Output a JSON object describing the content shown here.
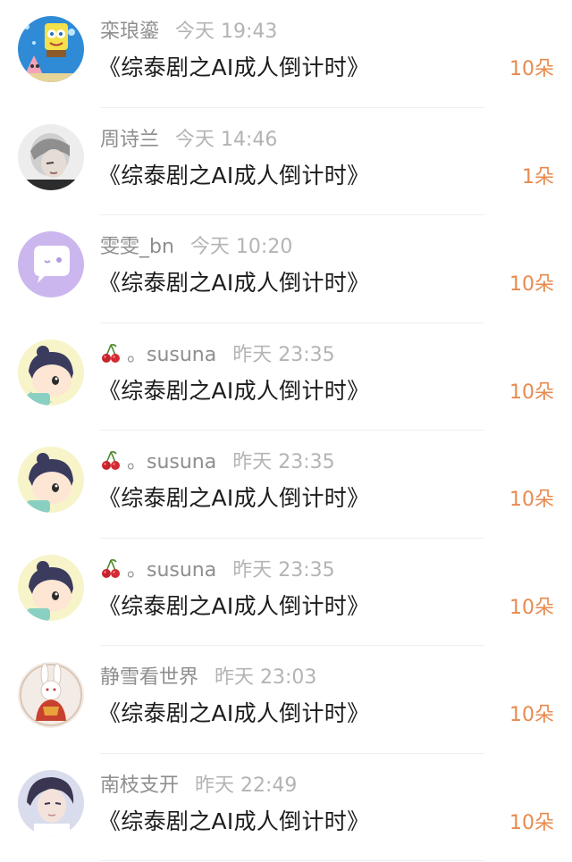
{
  "gifts": [
    {
      "name": "栾琅鎏",
      "time": "今天 19:43",
      "title": "《综泰剧之AI成人倒计时》",
      "count": "10朵",
      "avatar": "spongebob-avatar"
    },
    {
      "name": "周诗兰",
      "time": "今天 14:46",
      "title": "《综泰剧之AI成人倒计时》",
      "count": "1朵",
      "avatar": "grey-hair-person-avatar"
    },
    {
      "name": "雯雯_bn",
      "time": "今天 10:20",
      "title": "《综泰剧之AI成人倒计时》",
      "count": "10朵",
      "avatar": "purple-chat-bubble-avatar"
    },
    {
      "name": "。susuna",
      "time": "昨天 23:35",
      "title": "《综泰剧之AI成人倒计时》",
      "count": "10朵",
      "avatar": "cartoon-boy-avatar",
      "prefix_icon": "cherry-icon"
    },
    {
      "name": "。susuna",
      "time": "昨天 23:35",
      "title": "《综泰剧之AI成人倒计时》",
      "count": "10朵",
      "avatar": "cartoon-boy-avatar",
      "prefix_icon": "cherry-icon"
    },
    {
      "name": "。susuna",
      "time": "昨天 23:35",
      "title": "《综泰剧之AI成人倒计时》",
      "count": "10朵",
      "avatar": "cartoon-boy-avatar",
      "prefix_icon": "cherry-icon"
    },
    {
      "name": "静雪看世界",
      "time": "昨天 23:03",
      "title": "《综泰剧之AI成人倒计时》",
      "count": "10朵",
      "avatar": "rabbit-avatar"
    },
    {
      "name": "南枝支开",
      "time": "昨天 22:49",
      "title": "《综泰剧之AI成人倒计时》",
      "count": "10朵",
      "avatar": "young-man-avatar"
    }
  ],
  "colors": {
    "count": "#e88a4e",
    "name": "#8e8e8e",
    "time": "#b4b4b4",
    "title": "#1c1c1c"
  }
}
